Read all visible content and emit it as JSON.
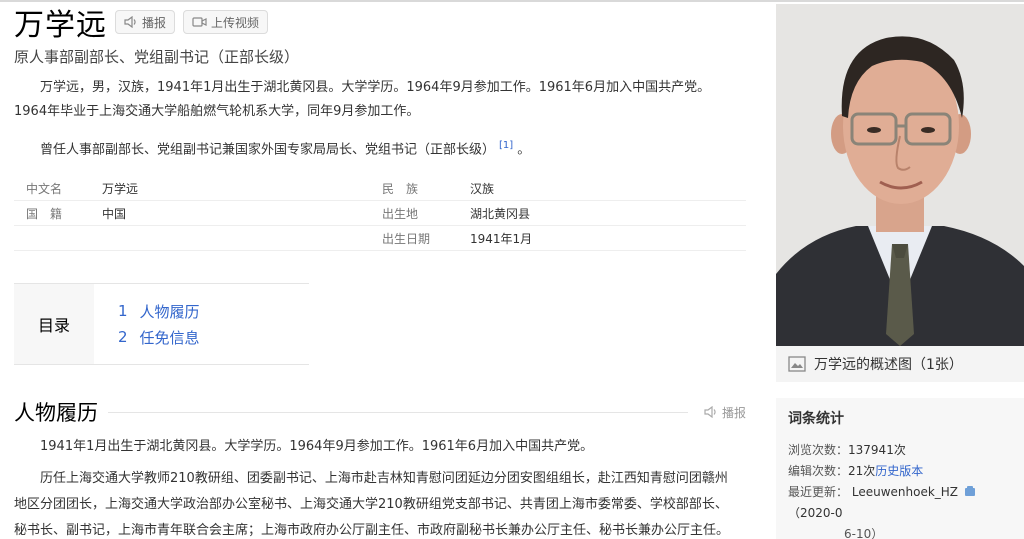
{
  "header": {
    "title": "万学远",
    "play_label": "播报",
    "upload_video_label": "上传视频",
    "subtitle": "原人事部副部长、党组副书记（正部长级）"
  },
  "summary": {
    "para1": "万学远，男，汉族，1941年1月出生于湖北黄冈县。大学学历。1964年9月参加工作。1961年6月加入中国共产党。1964年毕业于上海交通大学船舶燃气轮机系大学，同年9月参加工作。",
    "para2": "曾任人事部副部长、党组副书记兼国家外国专家局局长、党组书记（正部长级）",
    "ref": "[1]",
    "para2_end": "。"
  },
  "infobox": {
    "rows": [
      {
        "k1": "中文名",
        "v1": "万学远",
        "k2": "民　族",
        "v2": "汉族"
      },
      {
        "k1": "国　籍",
        "v1": "中国",
        "k2": "出生地",
        "v2": "湖北黄冈县"
      },
      {
        "k1": "",
        "v1": "",
        "k2": "出生日期",
        "v2": "1941年1月"
      }
    ]
  },
  "toc": {
    "label": "目录",
    "items": [
      {
        "num": "1",
        "label": "人物履历"
      },
      {
        "num": "2",
        "label": "任免信息"
      }
    ]
  },
  "section": {
    "heading": "人物履历",
    "play_label": "播报",
    "para1": "1941年1月出生于湖北黄冈县。大学学历。1964年9月参加工作。1961年6月加入中国共产党。",
    "para2_plain": "历任上海交通大学教师210教研组、团委副书记、上海市赴吉林知青慰问团延边分团安图组组长，赴江西知青慰问团赣州地区分团团长，上海交通大学政治部办公室秘书、上海交通大学210教研组党支部书记、共青团上海市委常委、学校部部长、秘书长、副书记，上海市青年联合会主席；",
    "para2_highlight": "上海市政府办公厅副主任、市政府副秘书长兼办公厅主任、秘书长兼办公厅主任。"
  },
  "sidebar": {
    "photo_caption": "万学远的概述图（1张）",
    "stats_title": "词条统计",
    "views_label": "浏览次数：",
    "views_value": "137941次",
    "edits_label": "编辑次数：",
    "edits_value": "21次",
    "history_link": "历史版本",
    "updated_label": "最近更新：",
    "updated_user": "Leeuwenhoek_HZ",
    "updated_date_a": "（2020-0",
    "updated_date_b": "6-10）"
  },
  "colors": {
    "link": "#3366cc",
    "highlight_underline": "#e01e1e"
  }
}
